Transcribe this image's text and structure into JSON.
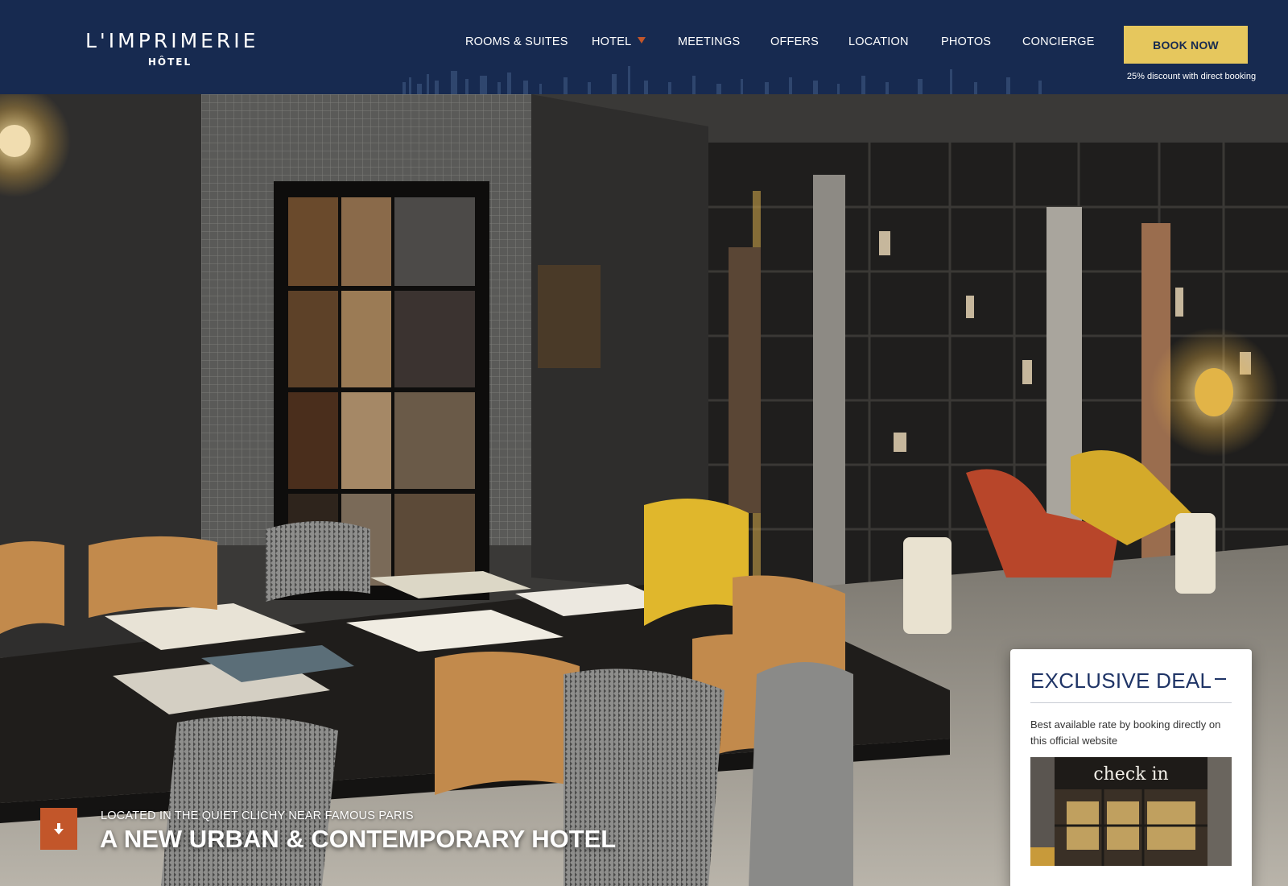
{
  "logo": {
    "name": "L'IMPRIMERIE",
    "sub": "HÔTEL"
  },
  "nav": {
    "items": [
      {
        "label": "ROOMS & SUITES"
      },
      {
        "label": "HOTEL",
        "has_dropdown": true
      },
      {
        "label": "MEETINGS"
      },
      {
        "label": "OFFERS"
      },
      {
        "label": "LOCATION"
      },
      {
        "label": "PHOTOS"
      },
      {
        "label": "CONCIERGE"
      }
    ]
  },
  "booking": {
    "button_label": "BOOK NOW",
    "note": "25% discount with direct booking"
  },
  "hero": {
    "subtitle": "LOCATED IN THE QUIET CLICHY NEAR FAMOUS PARIS",
    "title": "A NEW URBAN & CONTEMPORARY HOTEL",
    "scroll_icon": "arrow-down-icon"
  },
  "deal": {
    "title": "EXCLUSIVE DEAL",
    "collapse_icon": "minus-icon",
    "text": "Best available rate by booking directly on this official website",
    "image_sign": "check in"
  },
  "colors": {
    "header_bg": "#172a50",
    "book_button": "#e6c75d",
    "accent": "#c2562a",
    "deal_title": "#1f3466"
  }
}
